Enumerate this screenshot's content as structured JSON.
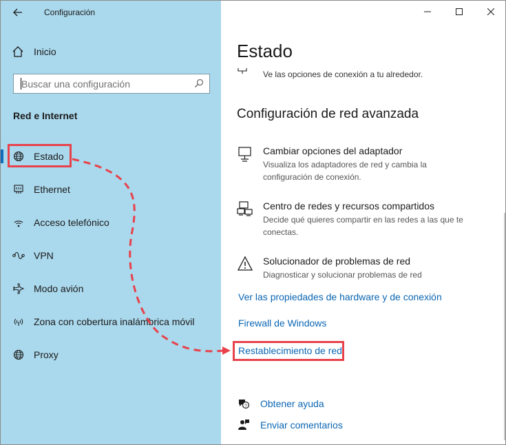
{
  "window": {
    "app_title": "Configuración"
  },
  "sidebar": {
    "home_label": "Inicio",
    "search_placeholder": "Buscar una configuración",
    "section_label": "Red e Internet",
    "items": [
      {
        "label": "Estado",
        "icon": "globe-icon",
        "active": true
      },
      {
        "label": "Ethernet",
        "icon": "ethernet-icon"
      },
      {
        "label": "Acceso telefónico",
        "icon": "dialup-icon"
      },
      {
        "label": "VPN",
        "icon": "vpn-icon"
      },
      {
        "label": "Modo avión",
        "icon": "airplane-icon"
      },
      {
        "label": "Zona con cobertura inalámbrica móvil",
        "icon": "hotspot-icon"
      },
      {
        "label": "Proxy",
        "icon": "globe-icon"
      }
    ]
  },
  "main": {
    "title": "Estado",
    "partial_text": "Ve las opciones de conexión a tu alrededor.",
    "advanced_title": "Configuración de red avanzada",
    "options": [
      {
        "title": "Cambiar opciones del adaptador",
        "desc": "Visualiza los adaptadores de red y cambia la configuración de conexión.",
        "icon": "network-adapter-icon"
      },
      {
        "title": "Centro de redes y recursos compartidos",
        "desc": "Decide qué quieres compartir en las redes a las que te conectas.",
        "icon": "sharing-center-icon"
      },
      {
        "title": "Solucionador de problemas de red",
        "desc": "Diagnosticar y solucionar problemas de red",
        "icon": "warning-icon"
      }
    ],
    "links": {
      "hardware": "Ver las propiedades de hardware y de conexión",
      "firewall": "Firewall de Windows",
      "reset": "Restablecimiento de red"
    },
    "help": {
      "get_help": "Obtener ayuda",
      "feedback": "Enviar comentarios"
    }
  },
  "colors": {
    "sidebar_bg": "#aad8ec",
    "accent": "#0b66b3",
    "highlight": "#e8414a"
  }
}
